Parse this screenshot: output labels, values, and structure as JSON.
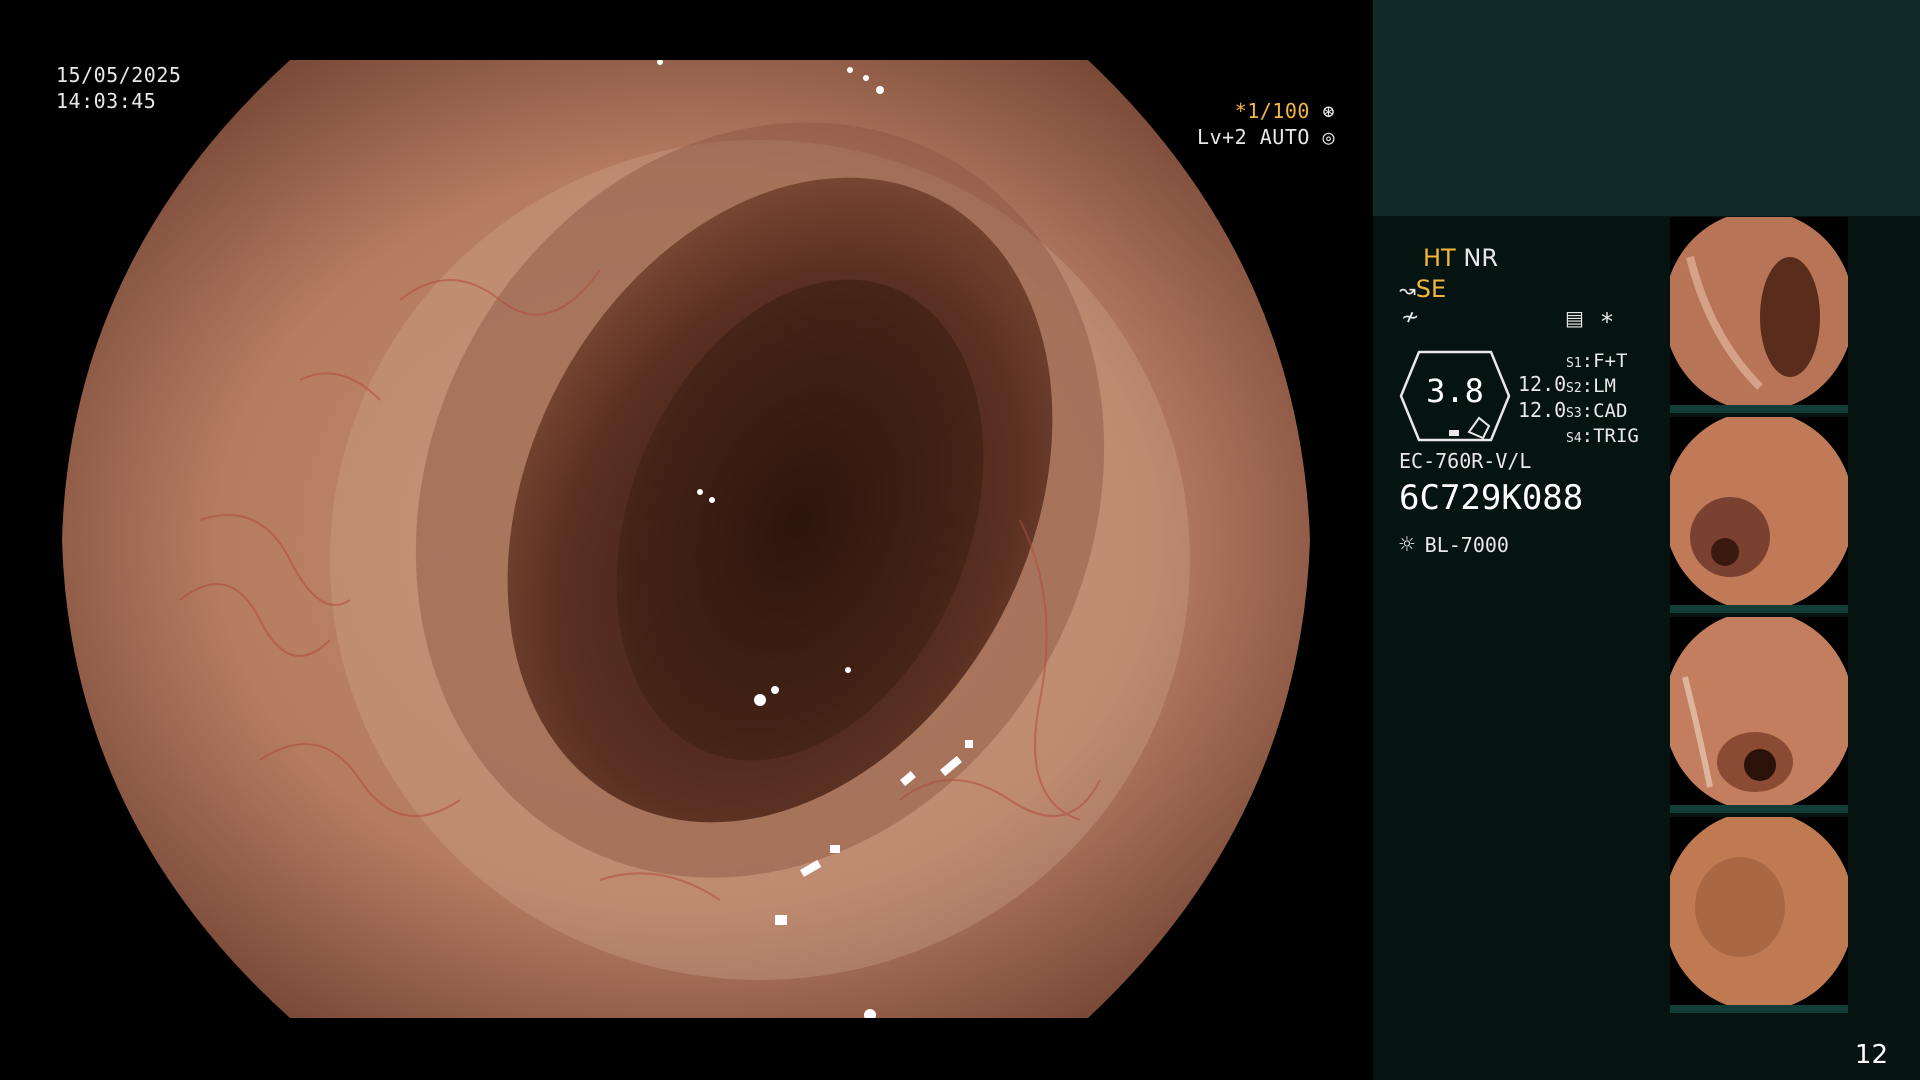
{
  "overlay": {
    "date": "15/05/2025",
    "time": "14:03:45",
    "shutter": "*1/100",
    "shutter_icon": "aperture-icon",
    "level": "Lv+2 AUTO",
    "level_icon": "iris-icon"
  },
  "panel": {
    "mode_ht": "HT",
    "mode_nr": "NR",
    "mode_se": "SE",
    "hexa_value": "3.8",
    "side_values": [
      "12.0",
      "12.0"
    ],
    "switches": [
      {
        "key": "S1",
        "label": "F+T"
      },
      {
        "key": "S2",
        "label": "LM"
      },
      {
        "key": "S3",
        "label": "CAD"
      },
      {
        "key": "S4",
        "label": "TRIG"
      }
    ],
    "scope_model": "EC-760R-V/L",
    "serial": "6C729K088",
    "light_source": "BL-7000",
    "page_number": "12"
  },
  "colors": {
    "accent_orange": "#f3b63d",
    "panel_bg": "#061411",
    "panel_top": "#0e2b27"
  }
}
